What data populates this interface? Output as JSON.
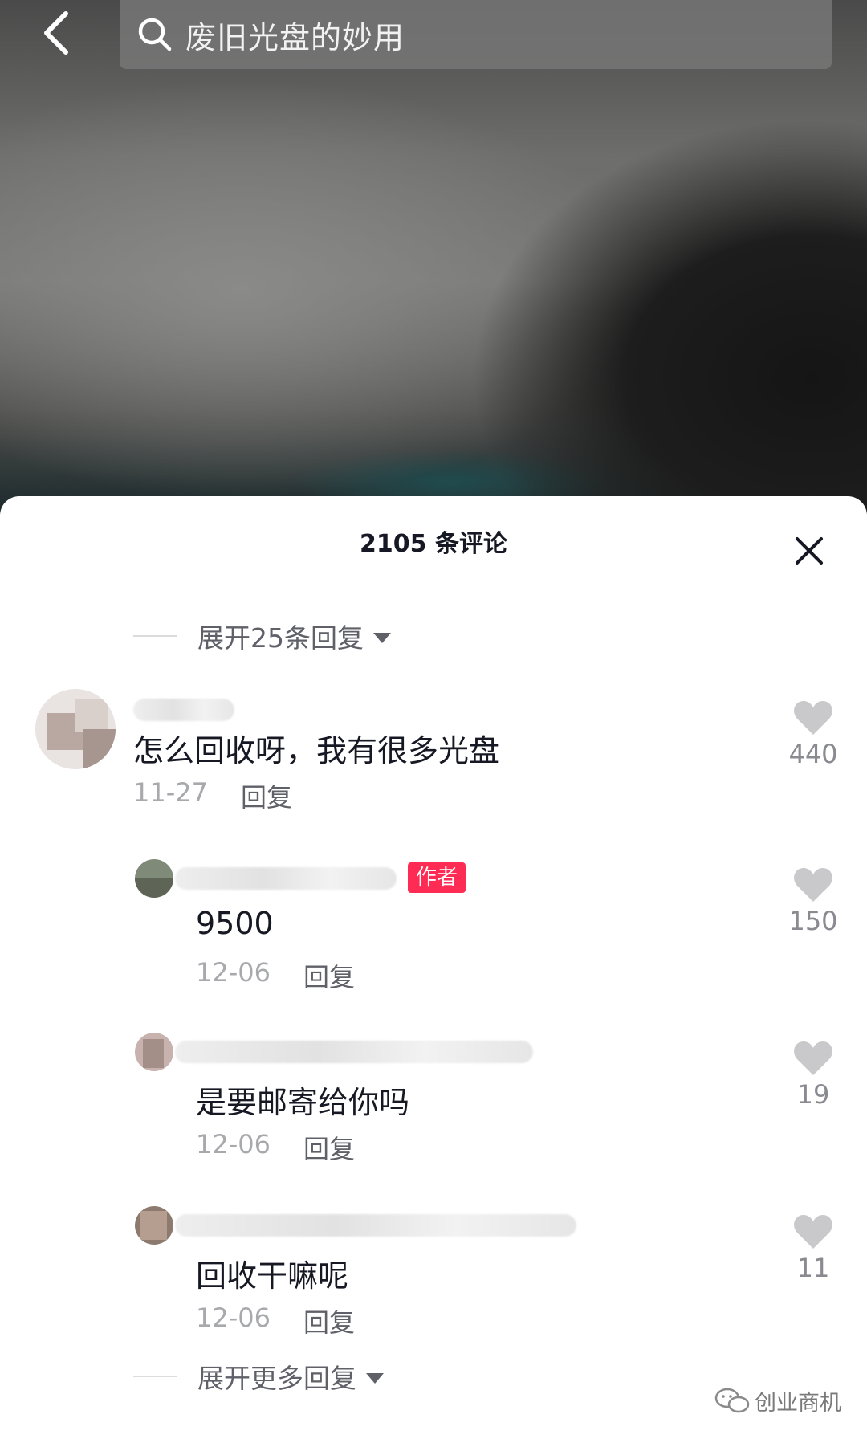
{
  "header": {
    "search_text": "废旧光盘的妙用"
  },
  "sheet": {
    "title": "2105 条评论",
    "expand_top": "展开25条回复",
    "expand_bottom": "展开更多回复"
  },
  "comments": [
    {
      "text": "怎么回收呀，我有很多光盘",
      "date": "11-27",
      "reply_label": "回复",
      "likes": "440"
    },
    {
      "text": "9500",
      "date": "12-06",
      "reply_label": "回复",
      "likes": "150",
      "badge": "作者"
    },
    {
      "text": "是要邮寄给你吗",
      "date": "12-06",
      "reply_label": "回复",
      "likes": "19"
    },
    {
      "text": "回收干嘛呢",
      "date": "12-06",
      "reply_label": "回复",
      "likes": "11"
    }
  ],
  "watermark": {
    "text": "创业商机",
    "icon": "wechat-icon"
  },
  "colors": {
    "badge": "#fe2c55",
    "heart": "#c9c9cc",
    "primary_text": "#161823",
    "secondary_text": "#a8a9ad"
  }
}
